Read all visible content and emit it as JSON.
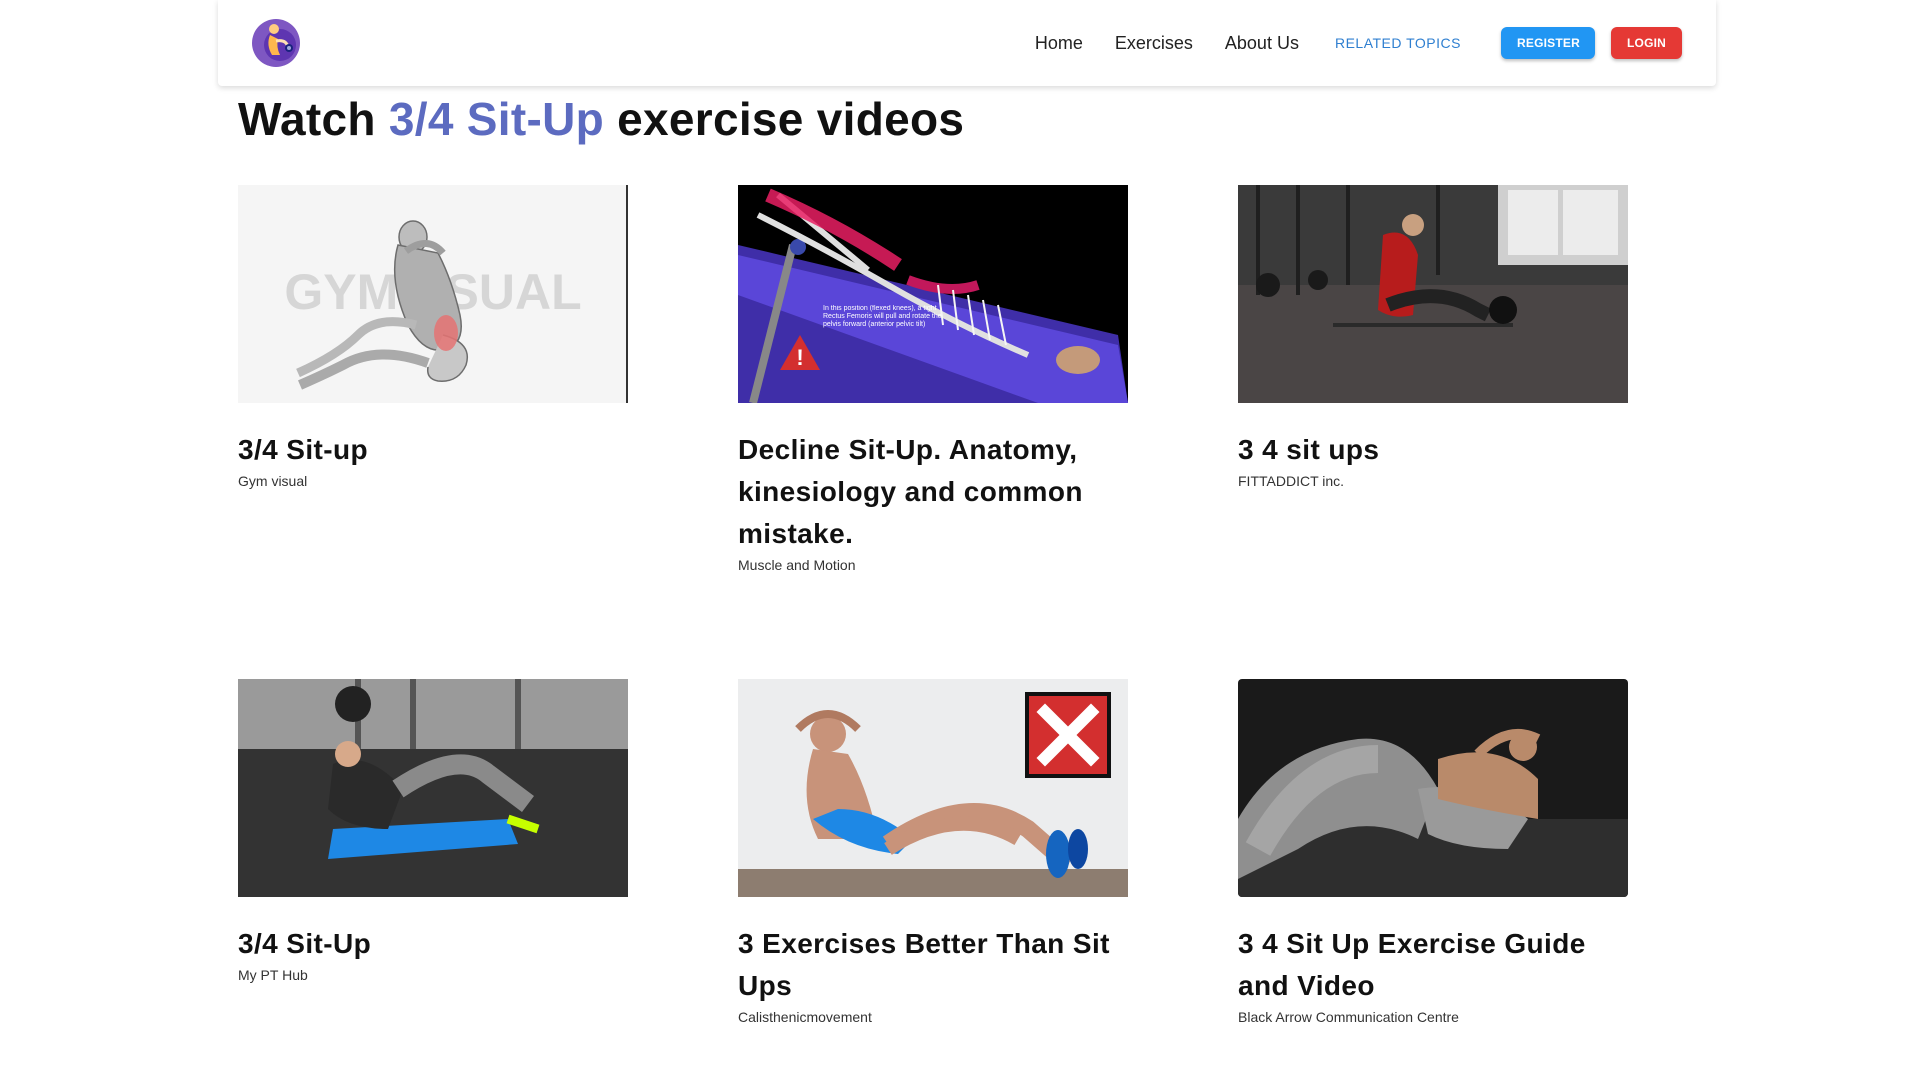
{
  "nav": {
    "links": [
      "Home",
      "Exercises",
      "About Us"
    ],
    "related_topics": "RELATED TOPICS",
    "register": "REGISTER",
    "login": "LOGIN"
  },
  "heading": {
    "prefix": "Watch ",
    "exercise": "3/4 Sit-Up",
    "suffix": " exercise videos"
  },
  "videos": [
    {
      "title": "3/4 Sit-up",
      "author": "Gym visual",
      "thumb_text": "GYMVISUAL"
    },
    {
      "title": "Decline Sit-Up. Anatomy, kinesiology and common mistake.",
      "author": "Muscle and Motion",
      "thumb_text": "In this position (flexed knees), a tight Rectus Femoris will pull and rotate the pelvis forward (anterior pelvic tilt)"
    },
    {
      "title": "3 4 sit ups",
      "author": "FITTADDICT inc."
    },
    {
      "title": "3/4 Sit-Up",
      "author": "My PT Hub"
    },
    {
      "title": "3 Exercises Better Than Sit Ups",
      "author": "Calisthenicmovement"
    },
    {
      "title": "3 4 Sit Up Exercise Guide and Video",
      "author": "Black Arrow Communication Centre"
    }
  ],
  "colors": {
    "accent": "#5c6bc0",
    "register": "#2196f3",
    "login": "#e53935",
    "related": "#2f7fd0"
  }
}
